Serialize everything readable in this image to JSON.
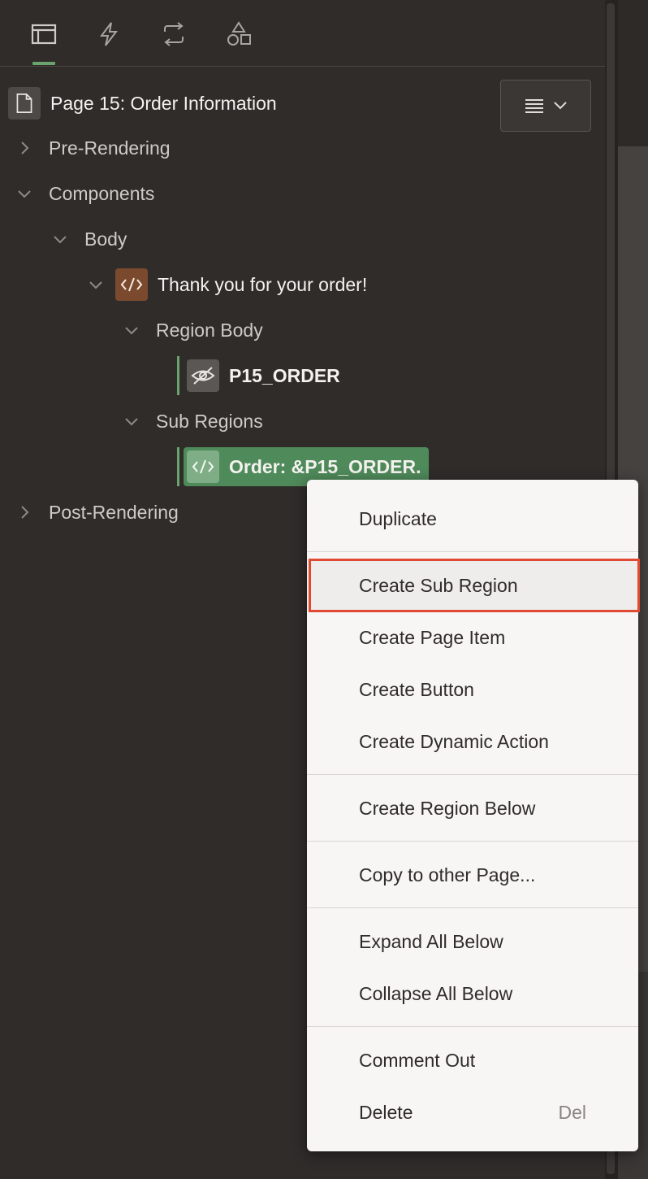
{
  "tabs": [
    {
      "name": "rendering-tab",
      "icon": "rendering-tree-icon",
      "active": true
    },
    {
      "name": "dynamic-actions-tab",
      "icon": "lightning-icon",
      "active": false
    },
    {
      "name": "processing-tab",
      "icon": "refresh-icon",
      "active": false
    },
    {
      "name": "shared-components-tab",
      "icon": "shapes-icon",
      "active": false
    }
  ],
  "header": {
    "page_title": "Page 15: Order Information",
    "page_icon": "page-icon",
    "menu_icon": "hamburger-menu-icon"
  },
  "tree": {
    "pre_rendering": "Pre-Rendering",
    "components": "Components",
    "body": "Body",
    "region": "Thank you for your order!",
    "region_body": "Region Body",
    "page_item": "P15_ORDER",
    "sub_regions": "Sub Regions",
    "sub_region": "Order: &P15_ORDER.",
    "post_rendering": "Post-Rendering"
  },
  "context_menu": {
    "duplicate": "Duplicate",
    "create_sub_region": "Create Sub Region",
    "create_page_item": "Create Page Item",
    "create_button": "Create Button",
    "create_dynamic_action": "Create Dynamic Action",
    "create_region_below": "Create Region Below",
    "copy_to_other_page": "Copy to other Page...",
    "expand_all_below": "Expand All Below",
    "collapse_all_below": "Collapse All Below",
    "comment_out": "Comment Out",
    "delete": "Delete",
    "delete_shortcut": "Del"
  },
  "colors": {
    "background": "#2f2c2a",
    "accent_green": "#6aa36b",
    "selected_row": "#4f8a5a",
    "region_icon": "#7b4a2e",
    "highlight_border": "#e04a32",
    "menu_background": "#f7f6f5"
  }
}
